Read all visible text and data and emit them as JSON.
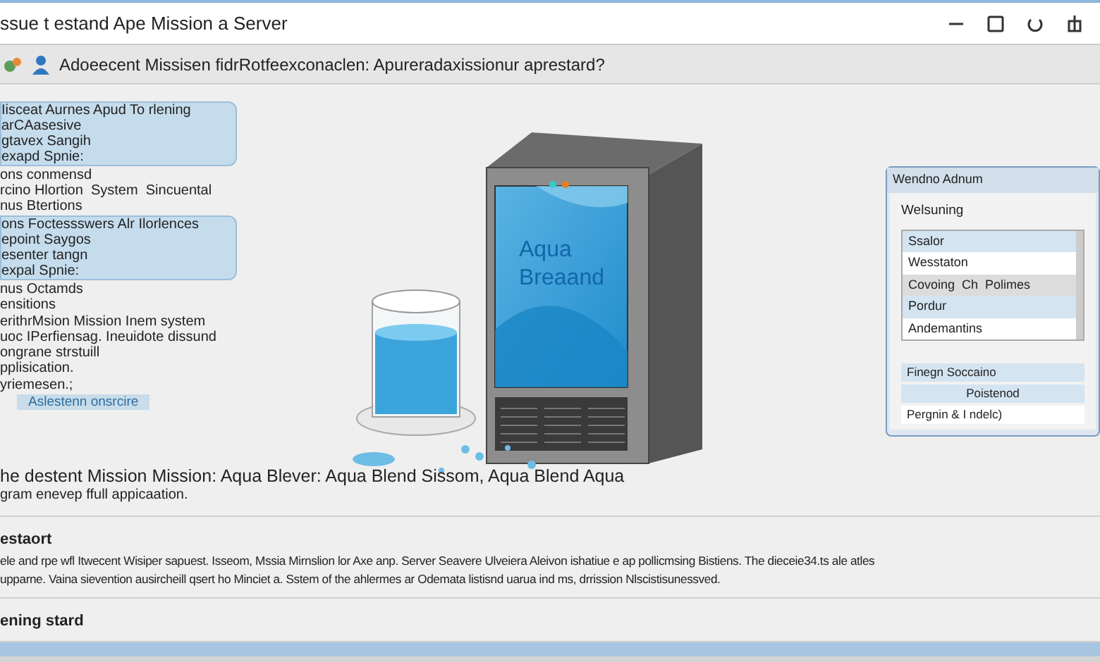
{
  "window": {
    "title": "ssue t estand Ape Mission a Server"
  },
  "toolbar": {
    "text": "Adoeecent Missisen fidrRotfeexconaclen: Apureradaxissionur aprestard?"
  },
  "left_blocks": [
    {
      "kind": "highlight",
      "lines": [
        "Iisceat Aurnes Apud To rlening",
        "arCAasesive",
        "gtavex Sangih",
        "exapd Spnie:"
      ]
    },
    {
      "kind": "text",
      "lines": [
        "ons conmensd",
        "rcino Hlortion  System  Sincuental",
        "nus Btertions"
      ]
    },
    {
      "kind": "highlight",
      "lines": [
        "ons Foctessswers Alr Ilorlences",
        "epoint Saygos",
        "esenter tangn",
        "expal Spnie:"
      ]
    },
    {
      "kind": "text",
      "lines": [
        "nus Octamds",
        "ensitions"
      ]
    },
    {
      "kind": "text",
      "lines": [
        "erithrMsion Mission Inem system",
        "uoc IPerfiensag. Ineuidote dissund",
        "ongrane strstuill",
        "pplisication."
      ]
    },
    {
      "kind": "text",
      "lines": [
        "yriemesen.;"
      ]
    },
    {
      "kind": "tag",
      "lines": [
        "Aslestenn onsrcire"
      ]
    }
  ],
  "illustration": {
    "screen_lines": [
      "Aqua",
      "Breaand"
    ]
  },
  "dialog": {
    "title": "Wendno Adnum",
    "label": "Welsuning",
    "list": [
      {
        "kind": "heading",
        "text": "Ssalor"
      },
      {
        "kind": "item",
        "text": "Wesstaton"
      },
      {
        "kind": "group",
        "text": "Covoing  Ch  Polimes"
      },
      {
        "kind": "heading",
        "text": "Pordur"
      },
      {
        "kind": "item",
        "text": "Andemantins"
      }
    ],
    "footer": [
      {
        "kind": "heading",
        "text": "Finegn Soccaino"
      },
      {
        "kind": "centered",
        "text": "Poistenod"
      },
      {
        "kind": "item",
        "text": "Pergnin & I ndelc)"
      }
    ]
  },
  "summary": [
    "he destent Mission Mission: Aqua Blever: Aqua Blend Sissom, Aqua Blend Aqua",
    "gram enevep ffull appicaation."
  ],
  "sections": [
    {
      "heading": "estaort",
      "lines": [
        "ele and rpe wfl Itwecent  Wisiper sapuest. Isseom, Mssia Mirnslion lor Axe anp. Server Seavere Ulveiera Aleivon ishatiue e ap pollicmsing Bistiens. The dieceie34.ts ale atles",
        "upparne. Vaina sievention ausircheill qsert ho Minciet a. Sstem of the ahlermes ar Odemata listisnd uarua ind ms, drrission Nlscistisunessved."
      ]
    },
    {
      "heading": "ening stard"
    }
  ]
}
